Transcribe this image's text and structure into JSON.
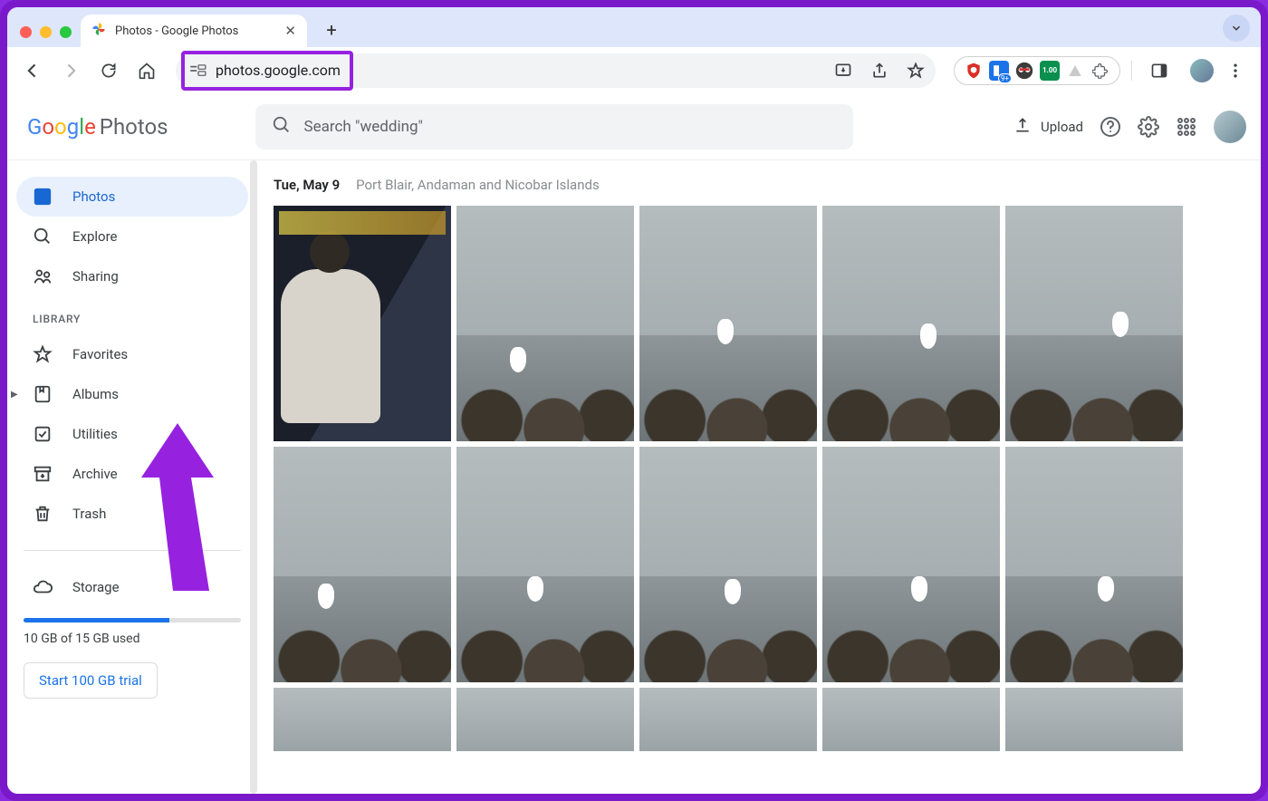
{
  "browser": {
    "tab_title": "Photos - Google Photos",
    "url": "photos.google.com",
    "ext_badge": "9+",
    "ext_badge2": "1.00"
  },
  "header": {
    "logo_suffix": "Photos",
    "search_placeholder": "Search \"wedding\"",
    "upload_label": "Upload"
  },
  "sidebar": {
    "nav": [
      {
        "label": "Photos"
      },
      {
        "label": "Explore"
      },
      {
        "label": "Sharing"
      }
    ],
    "section_label": "LIBRARY",
    "library": [
      {
        "label": "Favorites"
      },
      {
        "label": "Albums"
      },
      {
        "label": "Utilities"
      },
      {
        "label": "Archive"
      },
      {
        "label": "Trash"
      }
    ],
    "storage_label": "Storage",
    "storage_text": "10 GB of 15 GB used",
    "storage_pct": 67,
    "trial_label": "Start 100 GB trial"
  },
  "content": {
    "date": "Tue, May 9",
    "location": "Port Blair, Andaman and Nicobar Islands"
  }
}
